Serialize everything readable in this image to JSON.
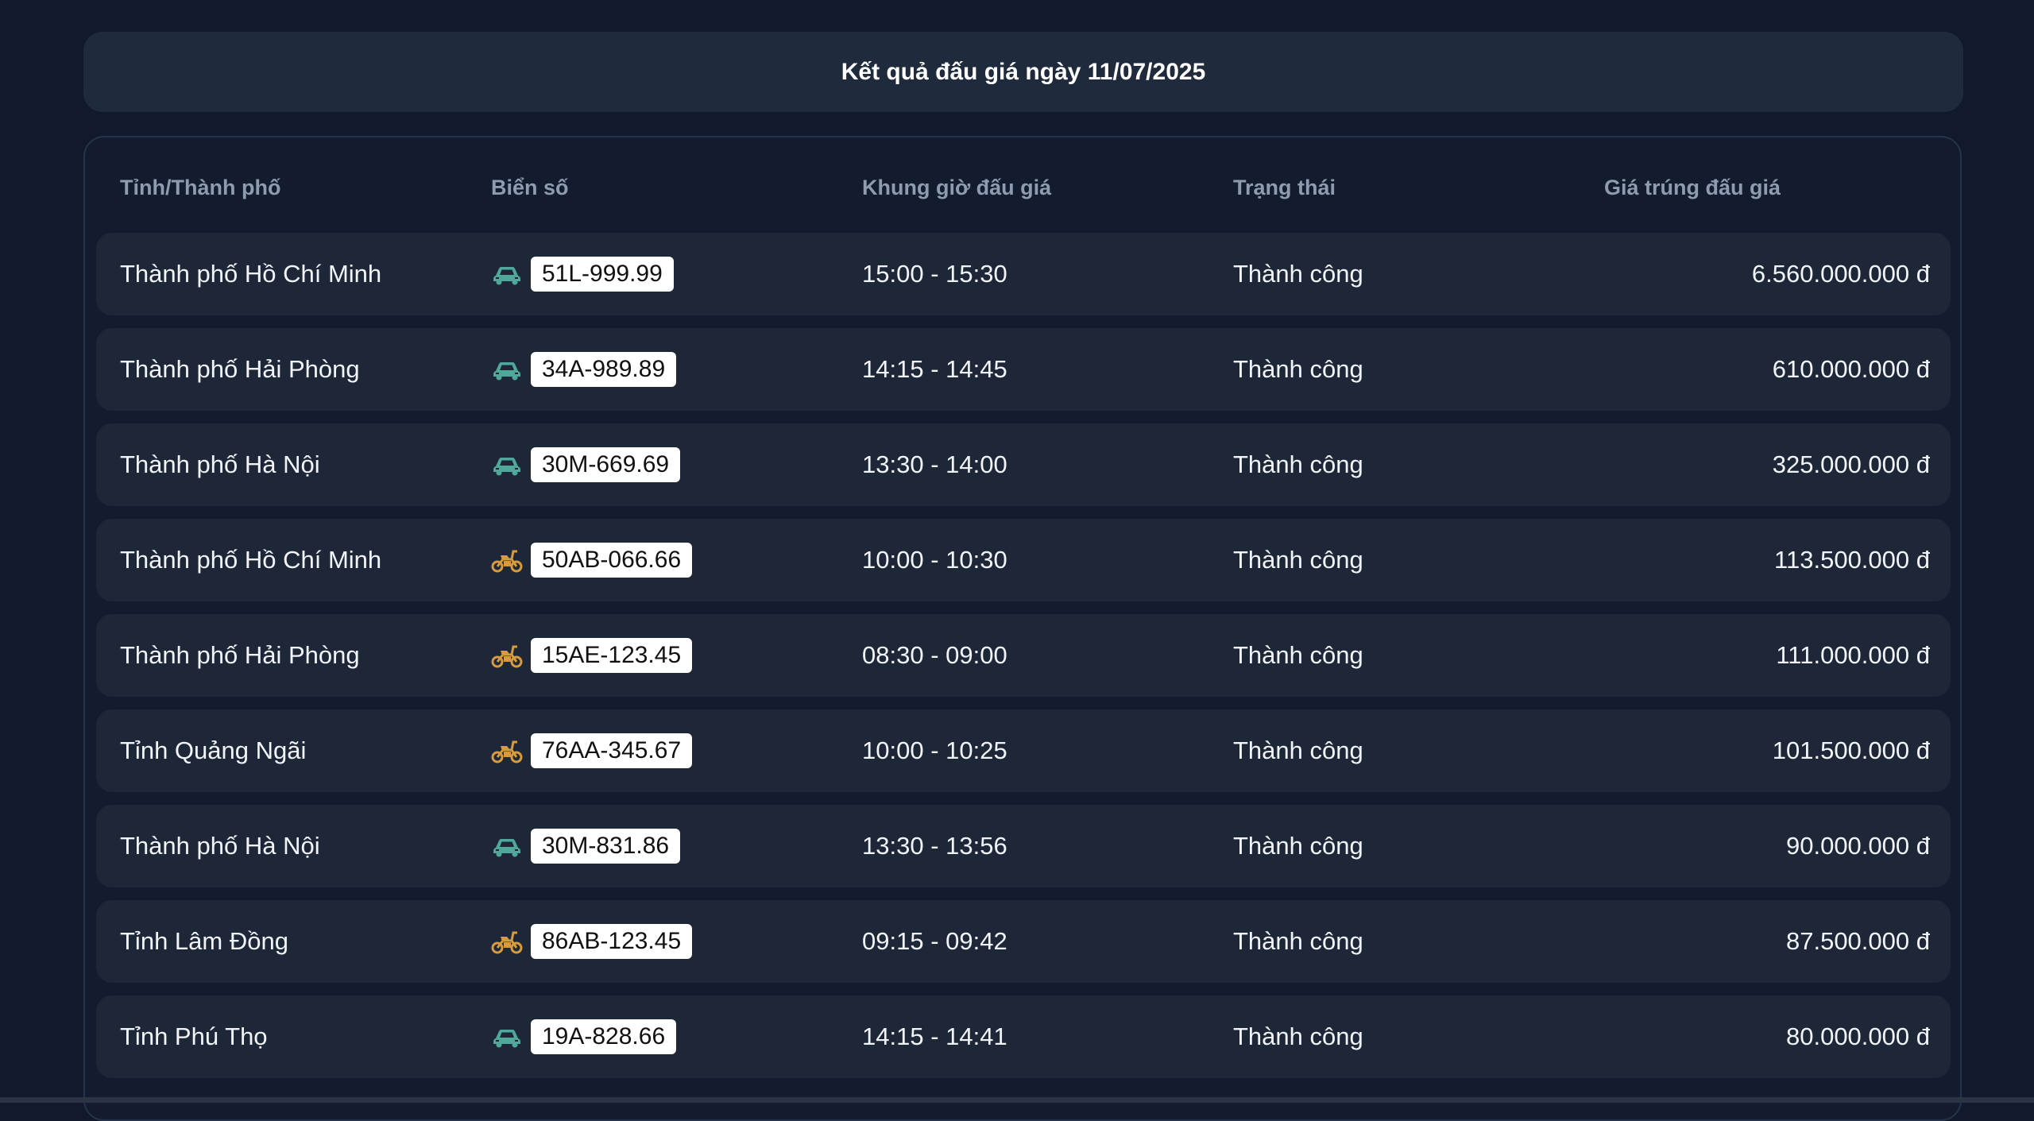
{
  "header": {
    "title": "Kết quả đấu giá ngày 11/07/2025"
  },
  "columns": {
    "province": "Tỉnh/Thành phố",
    "plate": "Biển số",
    "time_slot": "Khung giờ đấu giá",
    "status": "Trạng thái",
    "price": "Giá trúng đấu giá"
  },
  "colors": {
    "background": "#111a2c",
    "card": "#1f2a3c",
    "row": "#1d2737",
    "car_icon": "#4fa89a",
    "motorbike_icon": "#d79a3c",
    "plate_bg": "#ffffff"
  },
  "rows": [
    {
      "province": "Thành phố Hồ Chí Minh",
      "vehicle_icon": "car-icon",
      "plate": "51L-999.99",
      "time_slot": "15:00 - 15:30",
      "status": "Thành công",
      "price": "6.560.000.000 đ"
    },
    {
      "province": "Thành phố Hải Phòng",
      "vehicle_icon": "car-icon",
      "plate": "34A-989.89",
      "time_slot": "14:15 - 14:45",
      "status": "Thành công",
      "price": "610.000.000 đ"
    },
    {
      "province": "Thành phố Hà Nội",
      "vehicle_icon": "car-icon",
      "plate": "30M-669.69",
      "time_slot": "13:30 - 14:00",
      "status": "Thành công",
      "price": "325.000.000 đ"
    },
    {
      "province": "Thành phố Hồ Chí Minh",
      "vehicle_icon": "motorbike-icon",
      "plate": "50AB-066.66",
      "time_slot": "10:00 - 10:30",
      "status": "Thành công",
      "price": "113.500.000 đ"
    },
    {
      "province": "Thành phố Hải Phòng",
      "vehicle_icon": "motorbike-icon",
      "plate": "15AE-123.45",
      "time_slot": "08:30 - 09:00",
      "status": "Thành công",
      "price": "111.000.000 đ"
    },
    {
      "province": "Tỉnh Quảng Ngãi",
      "vehicle_icon": "motorbike-icon",
      "plate": "76AA-345.67",
      "time_slot": "10:00 - 10:25",
      "status": "Thành công",
      "price": "101.500.000 đ"
    },
    {
      "province": "Thành phố Hà Nội",
      "vehicle_icon": "car-icon",
      "plate": "30M-831.86",
      "time_slot": "13:30 - 13:56",
      "status": "Thành công",
      "price": "90.000.000 đ"
    },
    {
      "province": "Tỉnh Lâm Đồng",
      "vehicle_icon": "motorbike-icon",
      "plate": "86AB-123.45",
      "time_slot": "09:15 - 09:42",
      "status": "Thành công",
      "price": "87.500.000 đ"
    },
    {
      "province": "Tỉnh Phú Thọ",
      "vehicle_icon": "car-icon",
      "plate": "19A-828.66",
      "time_slot": "14:15 - 14:41",
      "status": "Thành công",
      "price": "80.000.000 đ"
    }
  ]
}
